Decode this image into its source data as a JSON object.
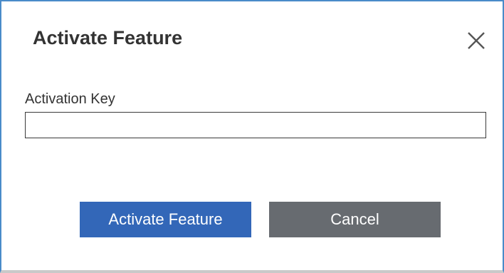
{
  "dialog": {
    "title": "Activate Feature",
    "close_icon": "close-icon",
    "field": {
      "label": "Activation Key",
      "value": "",
      "placeholder": ""
    },
    "buttons": {
      "primary_label": "Activate Feature",
      "secondary_label": "Cancel"
    }
  },
  "colors": {
    "accent_border": "#4a8bc9",
    "primary_button": "#3367b8",
    "secondary_button": "#676b70",
    "text": "#333333"
  }
}
